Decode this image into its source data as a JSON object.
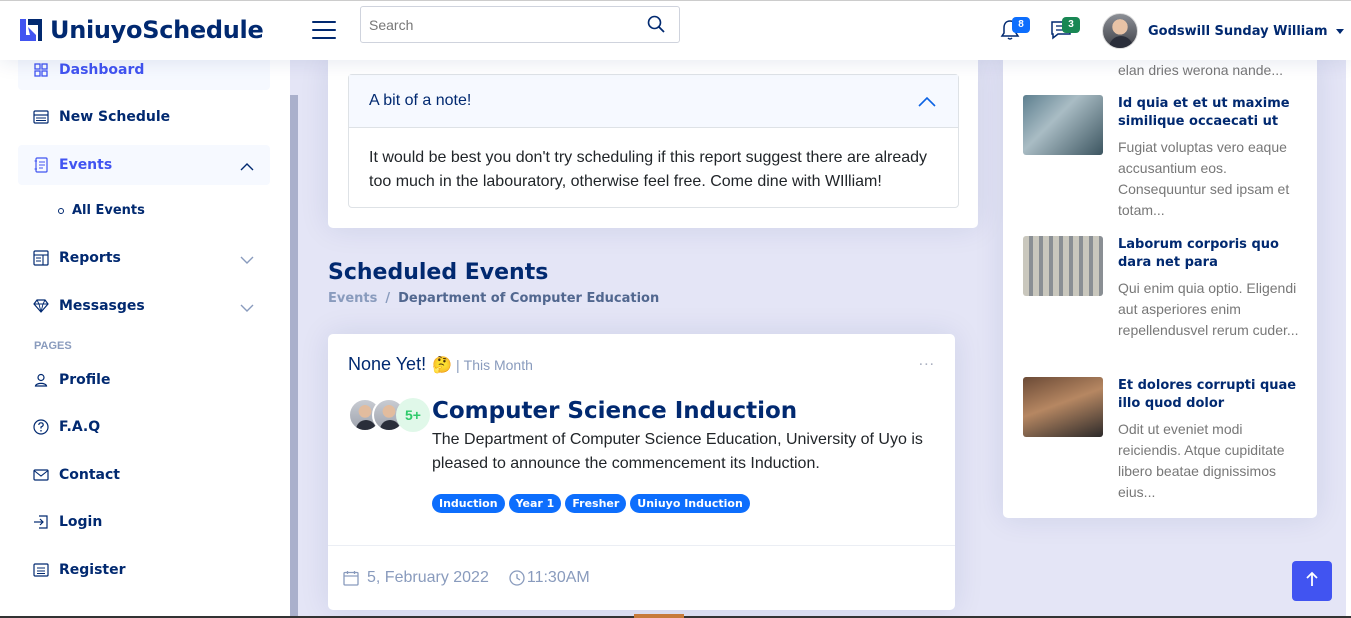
{
  "header": {
    "logo_text": "UniuyoSchedule",
    "search_placeholder": "Search",
    "notifications_count": "8",
    "messages_count": "3",
    "user_name": "Godswill Sunday William"
  },
  "sidebar": {
    "items": [
      {
        "label": "Dashboard",
        "icon": "grid-icon"
      },
      {
        "label": "New Schedule",
        "icon": "menu-button-icon"
      },
      {
        "label": "Events",
        "icon": "journal-text-icon"
      },
      {
        "label": "All Events"
      },
      {
        "label": "Reports",
        "icon": "layout-text-window-icon"
      },
      {
        "label": "Messasges",
        "icon": "gem-icon"
      }
    ],
    "pages_heading": "Pages",
    "pages": [
      {
        "label": "Profile",
        "icon": "person-icon"
      },
      {
        "label": "F.A.Q",
        "icon": "question-circle-icon"
      },
      {
        "label": "Contact",
        "icon": "envelope-icon"
      },
      {
        "label": "Login",
        "icon": "box-arrow-in-right-icon"
      },
      {
        "label": "Register",
        "icon": "card-list-icon"
      }
    ]
  },
  "note": {
    "title": "A bit of a note!",
    "body": "It would be best you don't try scheduling if this report suggest there are already too much in the labouratory, otherwise feel free. Come dine with WIlliam!"
  },
  "page_title": {
    "title": "Scheduled Events",
    "breadcrumb": [
      "Events",
      "Department of Computer Education"
    ],
    "separator": "/"
  },
  "event": {
    "status": "None Yet!",
    "emoji": "🤔",
    "divider": "|",
    "period": "This Month",
    "more": "...",
    "attendees_more": "5+",
    "title": "Computer Science Induction",
    "description": "The Department of Computer Science Education, University of Uyo is pleased to announce the commencement its Induction.",
    "tags": [
      "Induction",
      "Year 1",
      "Fresher",
      "Uniuyo Induction"
    ],
    "date": "5, February 2022",
    "time": "11:30AM"
  },
  "news": {
    "fragment": "elan dries werona nande...",
    "items": [
      {
        "title": "Id quia et et ut maxime similique occaecati ut",
        "text": "Fugiat voluptas vero eaque accusantium eos. Consequuntur sed ipsam et totam..."
      },
      {
        "title": "Laborum corporis quo dara net para",
        "text": "Qui enim quia optio. Eligendi aut asperiores enim repellendusvel rerum cuder..."
      },
      {
        "title": "Et dolores corrupti quae illo quod dolor",
        "text": "Odit ut eveniet modi reiciendis. Atque cupiditate libero beatae dignissimos eius..."
      }
    ]
  },
  "colors": {
    "brand": "#012970",
    "accent": "#4154f1",
    "tag": "#0d6efd",
    "background": "#e4e5f6"
  }
}
